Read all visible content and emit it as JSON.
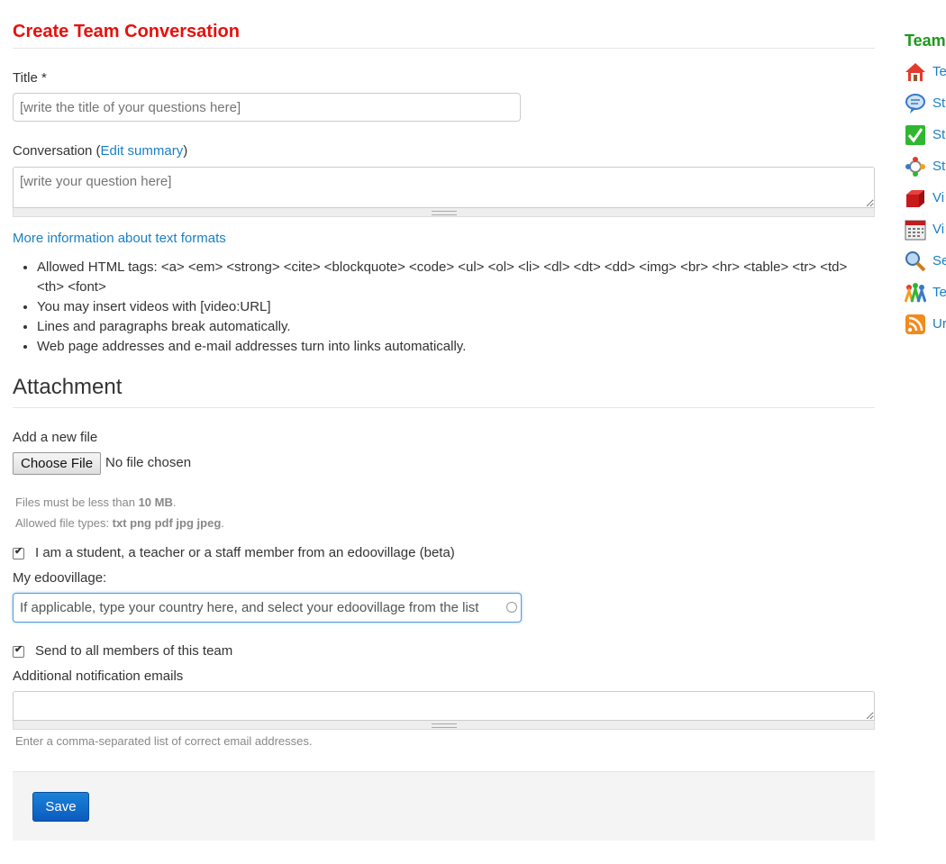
{
  "page": {
    "title": "Create Team Conversation"
  },
  "form": {
    "title_label": "Title *",
    "title_placeholder": "[write the title of your questions here]",
    "conversation_label_prefix": "Conversation (",
    "conversation_edit_summary": "Edit summary",
    "conversation_label_suffix": ")",
    "conversation_placeholder": "[write your question here]",
    "format_link": "More information about text formats",
    "format_tips": [
      "Allowed HTML tags: <a> <em> <strong> <cite> <blockquote> <code> <ul> <ol> <li> <dl> <dt> <dd> <img> <br> <hr> <table> <tr> <td> <th> <font>",
      "You may insert videos with [video:URL]",
      "Lines and paragraphs break automatically.",
      "Web page addresses and e-mail addresses turn into links automatically."
    ],
    "attachment_heading": "Attachment",
    "add_file_label": "Add a new file",
    "choose_file_button": "Choose File",
    "file_status": "No file chosen",
    "size_prefix": "Files must be less than ",
    "size_value": "10 MB",
    "size_suffix": ".",
    "types_prefix": "Allowed file types: ",
    "types_value": "txt png pdf jpg jpeg",
    "types_suffix": ".",
    "student_checkbox_label": "I am a student, a teacher or a staff member from an edoovillage (beta)",
    "student_checked": true,
    "village_label": "My edoovillage:",
    "village_value": "If applicable, type your country here, and select your edoovillage from the list",
    "send_all_label": "Send to all members of this team",
    "send_all_checked": true,
    "notify_label": "Additional notification emails",
    "notify_value": "",
    "notify_help": "Enter a comma-separated list of correct email addresses.",
    "save_button": "Save"
  },
  "sidebar": {
    "title": "Team",
    "items": [
      {
        "label": "Te",
        "icon": "home-icon"
      },
      {
        "label": "St",
        "icon": "speech-bubble-icon"
      },
      {
        "label": "St",
        "icon": "checkmark-icon"
      },
      {
        "label": "St",
        "icon": "network-icon"
      },
      {
        "label": "Vi",
        "icon": "red-box-icon"
      },
      {
        "label": "Vi",
        "icon": "calendar-icon"
      },
      {
        "label": "Se",
        "icon": "magnifier-icon"
      },
      {
        "label": "Te",
        "icon": "people-icon"
      },
      {
        "label": "Ur",
        "icon": "rss-icon"
      }
    ]
  },
  "colors": {
    "title_red": "#e8100c",
    "link_blue": "#1a7fc4",
    "sidebar_green": "#1c9a1c",
    "save_blue": "#0b5bbf"
  }
}
